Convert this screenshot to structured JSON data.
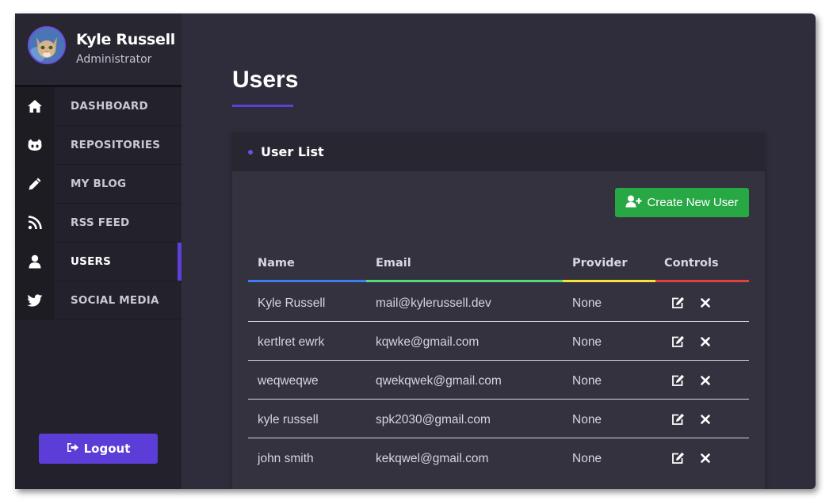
{
  "user": {
    "name": "Kyle Russell",
    "role": "Administrator"
  },
  "nav": [
    {
      "label": "DASHBOARD",
      "icon": "home-icon"
    },
    {
      "label": "REPOSITORIES",
      "icon": "github-icon"
    },
    {
      "label": "MY BLOG",
      "icon": "pencil-icon"
    },
    {
      "label": "RSS FEED",
      "icon": "rss-icon"
    },
    {
      "label": "USERS",
      "icon": "user-icon",
      "active": true
    },
    {
      "label": "SOCIAL MEDIA",
      "icon": "twitter-icon"
    }
  ],
  "logout_label": "Logout",
  "page": {
    "title": "Users"
  },
  "card": {
    "title": "User List",
    "create_button": "Create New User"
  },
  "table": {
    "columns": [
      "Name",
      "Email",
      "Provider",
      "Controls"
    ],
    "column_colors": [
      "#3d7cf0",
      "#4fdc7a",
      "#f5e23b",
      "#e04040"
    ],
    "rows": [
      {
        "name": "Kyle Russell",
        "email": "mail@kylerussell.dev",
        "provider": "None"
      },
      {
        "name": "kertlret ewrk",
        "email": "kqwke@gmail.com",
        "provider": "None"
      },
      {
        "name": "weqweqwe",
        "email": "qwekqwek@gmail.com",
        "provider": "None"
      },
      {
        "name": "kyle russell",
        "email": "spk2030@gmail.com",
        "provider": "None"
      },
      {
        "name": "john smith",
        "email": "kekqwel@gmail.com",
        "provider": "None"
      }
    ]
  },
  "colors": {
    "accent": "#5f3fd9",
    "success": "#28a745",
    "sidebar": "#23212b",
    "main": "#2f2d3b"
  }
}
